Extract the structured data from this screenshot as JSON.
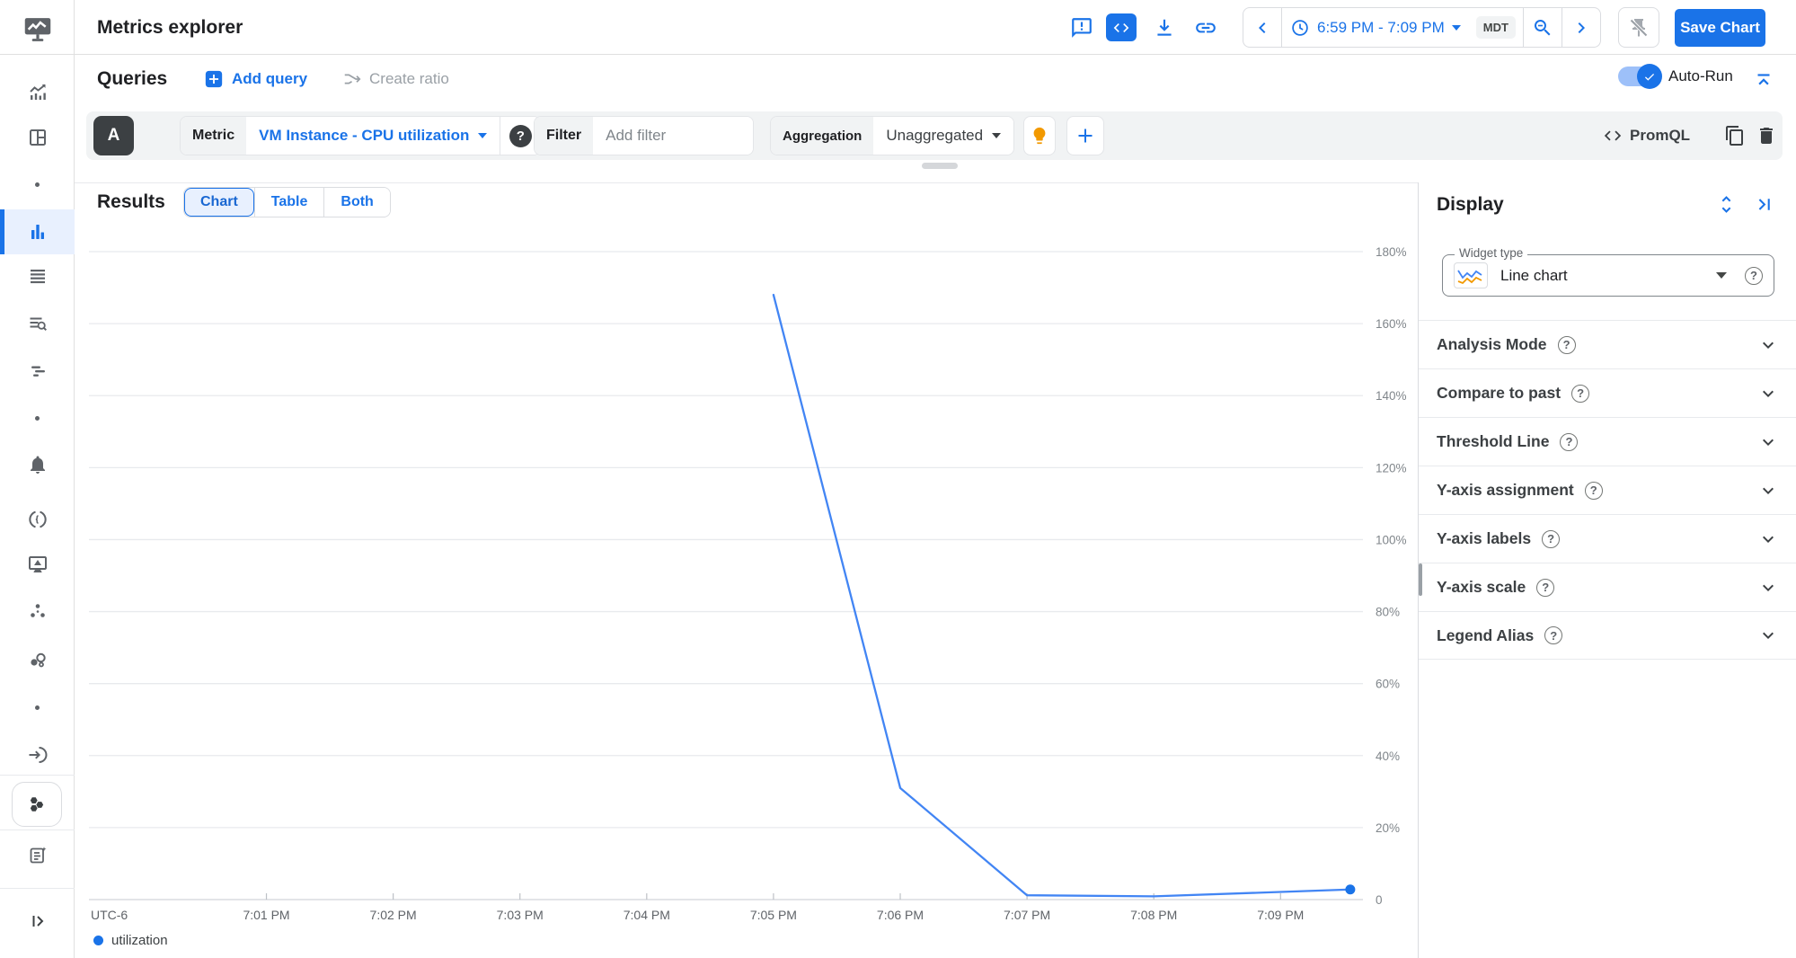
{
  "header": {
    "title": "Metrics explorer",
    "time_range": "6:59 PM - 7:09 PM",
    "timezone": "MDT",
    "save_button": "Save Chart"
  },
  "queries": {
    "heading": "Queries",
    "add_query": "Add query",
    "create_ratio": "Create ratio",
    "auto_run": "Auto-Run"
  },
  "query_builder": {
    "letter": "A",
    "metric_label": "Metric",
    "metric_value": "VM Instance - CPU utilization",
    "filter_label": "Filter",
    "filter_placeholder": "Add filter",
    "aggregation_label": "Aggregation",
    "aggregation_value": "Unaggregated",
    "promql_label": "PromQL"
  },
  "results": {
    "heading": "Results",
    "tabs": [
      {
        "label": "Chart",
        "selected": true
      },
      {
        "label": "Table",
        "selected": false
      },
      {
        "label": "Both",
        "selected": false
      }
    ]
  },
  "display_panel": {
    "heading": "Display",
    "widget_type_label": "Widget type",
    "widget_type_value": "Line chart",
    "sections": [
      "Analysis Mode",
      "Compare to past",
      "Threshold Line",
      "Y-axis assignment",
      "Y-axis labels",
      "Y-axis scale",
      "Legend Alias"
    ]
  },
  "glyphs": {
    "question": "?"
  },
  "icons": [
    "feedback-icon",
    "embed-code-icon",
    "download-icon",
    "get-link-icon",
    "clock-icon",
    "zoom-out-icon",
    "pin-off-icon",
    "lightbulb-icon",
    "copy-icon",
    "trash-icon"
  ],
  "colors": {
    "accent_blue": "#1a73e8",
    "line_blue": "#4285f4",
    "selected_bg": "#e8f0fe",
    "builder_row_bg": "#f1f3f4",
    "border": "#dadce0",
    "text_primary": "#202124",
    "text_secondary": "#5f6368",
    "lightbulb_orange": "#f29900",
    "query_badge_bg": "#3c4043"
  },
  "chart_data": {
    "type": "line",
    "title": "",
    "xlabel": "",
    "ylabel": "",
    "timezone_label": "UTC-6",
    "x_unit": "minutes after 7:00 PM (MDT)",
    "xlim": [
      -0.4,
      9.65
    ],
    "ylim": [
      0,
      183
    ],
    "grid": "horizontal",
    "legend_position": "bottom-left",
    "x_ticks": [
      {
        "t": 1,
        "label": "7:01 PM"
      },
      {
        "t": 2,
        "label": "7:02 PM"
      },
      {
        "t": 3,
        "label": "7:03 PM"
      },
      {
        "t": 4,
        "label": "7:04 PM"
      },
      {
        "t": 5,
        "label": "7:05 PM"
      },
      {
        "t": 6,
        "label": "7:06 PM"
      },
      {
        "t": 7,
        "label": "7:07 PM"
      },
      {
        "t": 8,
        "label": "7:08 PM"
      },
      {
        "t": 9,
        "label": "7:09 PM"
      }
    ],
    "y_ticks": [
      {
        "v": 180,
        "label": "180%"
      },
      {
        "v": 160,
        "label": "160%"
      },
      {
        "v": 140,
        "label": "140%"
      },
      {
        "v": 120,
        "label": "120%"
      },
      {
        "v": 100,
        "label": "100%"
      },
      {
        "v": 80,
        "label": "80%"
      },
      {
        "v": 60,
        "label": "60%"
      },
      {
        "v": 40,
        "label": "40%"
      },
      {
        "v": 20,
        "label": "20%"
      },
      {
        "v": 0,
        "label": "0"
      }
    ],
    "series": [
      {
        "name": "utilization",
        "color": "#4285f4",
        "endpoint_dot": true,
        "endpoint_dot_color": "#1a73e8",
        "points": [
          [
            5.0,
            168
          ],
          [
            6.0,
            31
          ],
          [
            7.0,
            1.2
          ],
          [
            8.0,
            0.9
          ],
          [
            9.55,
            2.8
          ]
        ]
      }
    ]
  }
}
